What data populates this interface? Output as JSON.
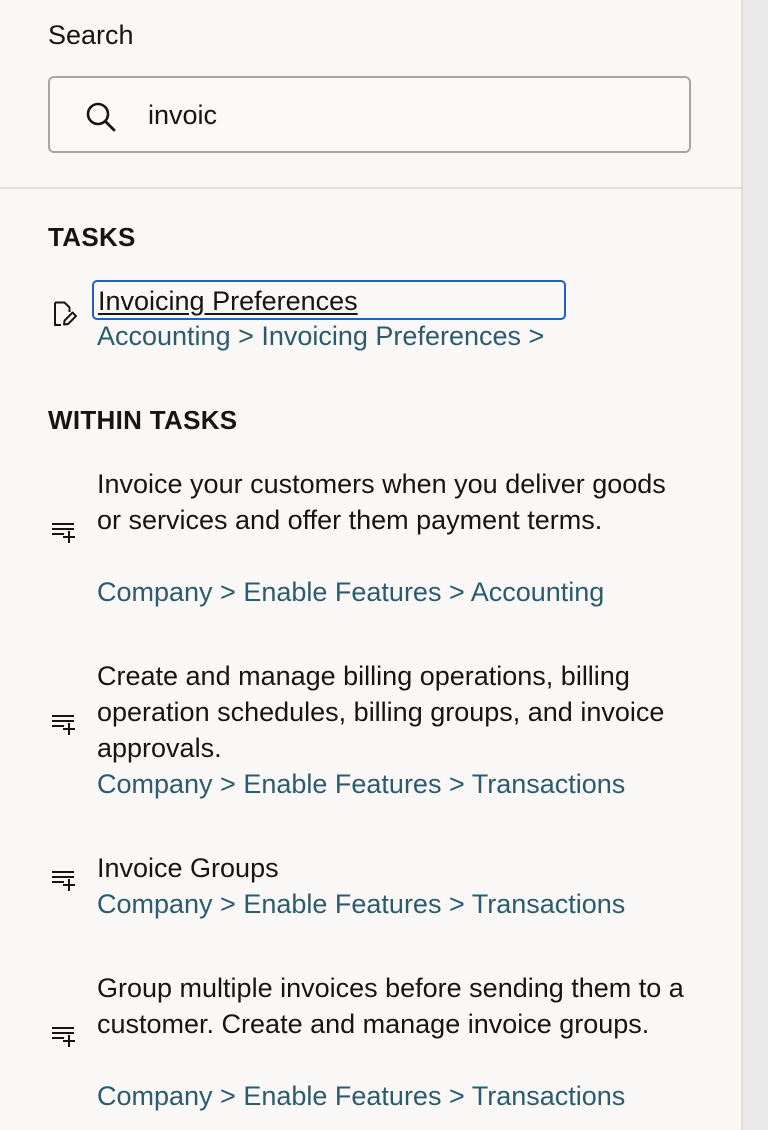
{
  "search": {
    "label": "Search",
    "query": "invoic"
  },
  "tasks_section": {
    "heading": "TASKS",
    "items": [
      {
        "title": "Invoicing Preferences",
        "path": "Accounting > Invoicing Preferences >",
        "icon": "edit-document-icon"
      }
    ]
  },
  "within_tasks_section": {
    "heading": "WITHIN TASKS",
    "items": [
      {
        "text": "Invoice your customers when you deliver goods or services and offer them payment terms.",
        "path": "Company > Enable Features > Accounting",
        "icon": "list-add-icon"
      },
      {
        "text": "Create and manage billing operations, billing operation schedules, billing groups, and invoice approvals.",
        "path": "Company > Enable Features > Transactions",
        "icon": "list-add-icon"
      },
      {
        "text": "Invoice Groups",
        "path": "Company > Enable Features > Transactions",
        "icon": "list-add-icon"
      },
      {
        "text": "Group multiple invoices before sending them to a customer. Create and manage invoice groups.",
        "path": "Company > Enable Features > Transactions",
        "icon": "list-add-icon"
      }
    ]
  },
  "colors": {
    "panel_background": "#f9f8f6",
    "text": "#161513",
    "path_link": "#2c5b6e",
    "focus_ring": "#1f5fc6",
    "input_border": "#a9a6a2"
  }
}
